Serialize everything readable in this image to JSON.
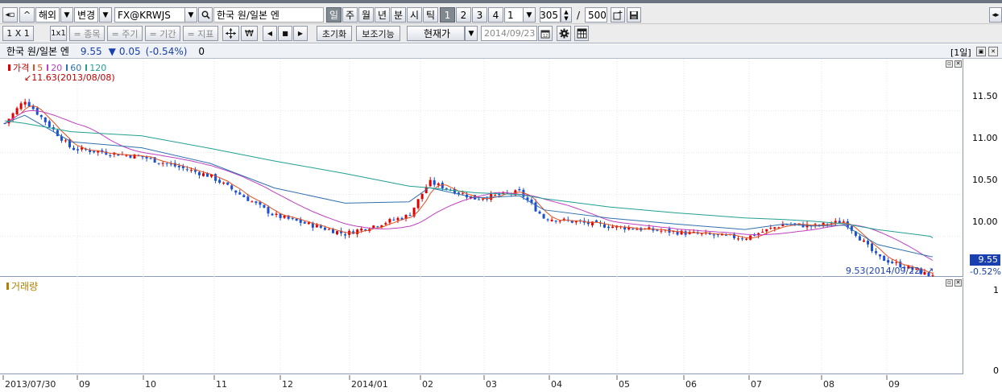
{
  "toolbar1": {
    "market": "해외",
    "change_label": "변경",
    "symbol": "FX@KRWJS",
    "symbol_name": "한국 원/일본 엔",
    "periods": [
      "일",
      "주",
      "월",
      "년",
      "분",
      "시",
      "틱"
    ],
    "active_period": "일",
    "multipliers": [
      "1",
      "2",
      "3",
      "4"
    ],
    "active_multiplier": "1",
    "interval_value": "1",
    "count_value": "305",
    "count_sep": "/",
    "count_total": "500"
  },
  "toolbar2": {
    "layout_label": "1 X 1",
    "stock_label": "= 종목",
    "cycle_label": "= 주기",
    "period_label": "= 기간",
    "indicator_label": "= 지표",
    "currency_symbol": "₩",
    "reset_label": "초기화",
    "aux_label": "보조기능",
    "price_type": "현재가",
    "date_value": "2014/09/23"
  },
  "info": {
    "name": "한국 원/일본 엔",
    "price": "9.55",
    "arrow": "▼",
    "change": "0.05",
    "change_pct": "(-0.54%)",
    "volume": "0",
    "period_badge": "[1일]"
  },
  "legend": {
    "price_label": "가격",
    "ma": [
      "5",
      "20",
      "60",
      "120"
    ],
    "volume_label": "거래량"
  },
  "annotations": {
    "high": "11.63(2013/08/08)",
    "low": "9.53(2014/09/22)"
  },
  "price_axis": {
    "ticks": [
      "11.50",
      "11.00",
      "10.50",
      "10.00"
    ],
    "current": "9.55",
    "current_pct": "-0.52%"
  },
  "volume_axis": {
    "ticks": [
      "1",
      "0"
    ]
  },
  "x_axis": {
    "labels": [
      "2013/07/30",
      "09",
      "10",
      "11",
      "12",
      "2014/01",
      "02",
      "03",
      "04",
      "05",
      "06",
      "07",
      "08",
      "09"
    ]
  },
  "colors": {
    "up": "#e00000",
    "down": "#1a4fd6",
    "ma5": "#e05020",
    "ma20": "#c040c0",
    "ma60": "#3070b0",
    "ma120": "#20a090",
    "vol_label": "#b08000"
  },
  "chart_data": {
    "type": "line",
    "title": "한국 원/일본 엔",
    "series": [
      {
        "name": "가격",
        "x": [
          "2013/07/30",
          "2013/08/08",
          "2013/08/29",
          "2013/09/30",
          "2013/10/31",
          "2013/11/29",
          "2013/12/31",
          "2014/01/29",
          "2014/02/07",
          "2014/02/28",
          "2014/03/20",
          "2014/03/31",
          "2014/04/30",
          "2014/05/30",
          "2014/06/30",
          "2014/07/18",
          "2014/07/31",
          "2014/08/14",
          "2014/08/29",
          "2014/09/22",
          "2014/09/23"
        ],
        "values": [
          11.35,
          11.63,
          11.05,
          10.95,
          10.72,
          10.25,
          10.03,
          10.25,
          10.65,
          10.45,
          10.53,
          10.22,
          10.12,
          10.05,
          9.98,
          10.15,
          10.12,
          10.18,
          9.75,
          9.53,
          9.55
        ]
      },
      {
        "name": "120",
        "values": [
          11.38,
          11.35,
          11.25,
          11.2,
          11.05,
          10.9,
          10.75,
          10.6,
          10.58,
          10.52,
          10.5,
          10.45,
          10.35,
          10.28,
          10.22,
          10.2,
          10.18,
          10.15,
          10.08,
          10.0,
          9.98
        ]
      }
    ],
    "ylim": [
      9.4,
      11.8
    ]
  }
}
